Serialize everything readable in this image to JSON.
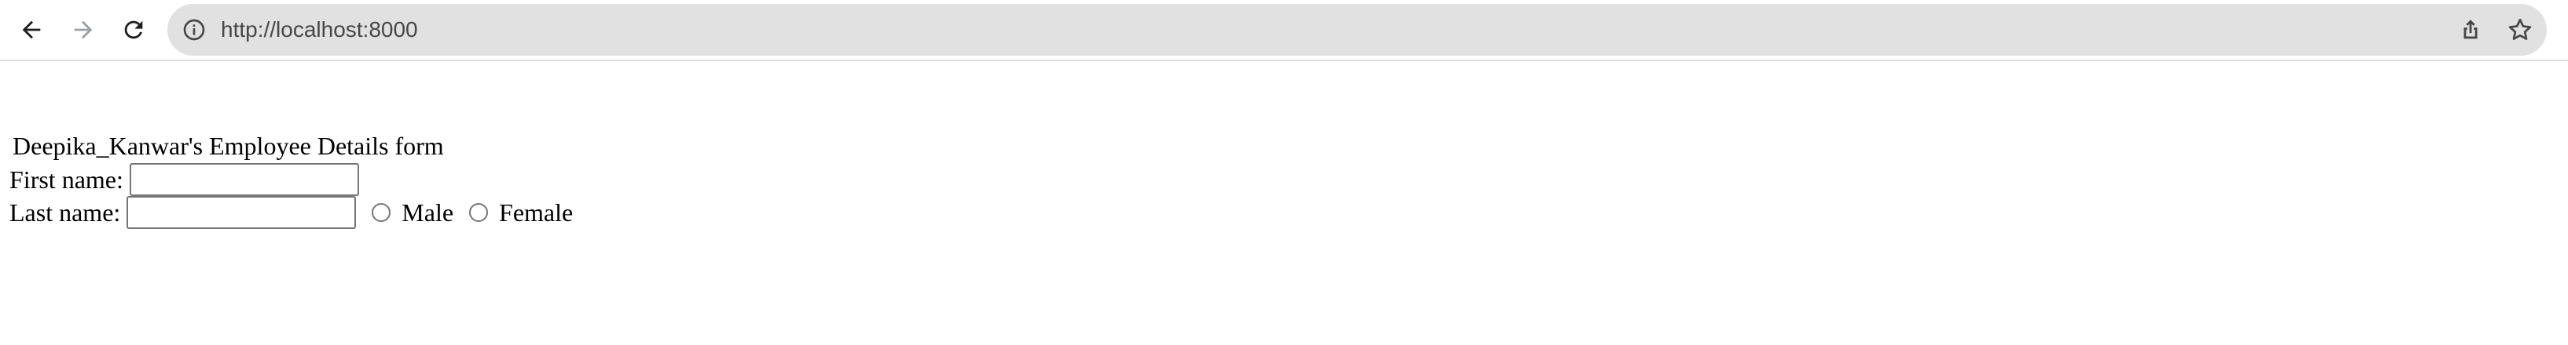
{
  "browser": {
    "url": "http://localhost:8000",
    "icons": {
      "back": "arrow-left-icon",
      "forward": "arrow-right-icon",
      "reload": "reload-icon",
      "site_info": "info-icon",
      "share": "share-icon",
      "bookmark": "star-icon"
    }
  },
  "form": {
    "title": "Deepika_Kanwar's Employee Details form",
    "first_name_label": "First name:",
    "first_name_value": "",
    "last_name_label": "Last name:",
    "last_name_value": "",
    "gender_options": [
      "Male",
      "Female"
    ],
    "gender_selected": null
  }
}
